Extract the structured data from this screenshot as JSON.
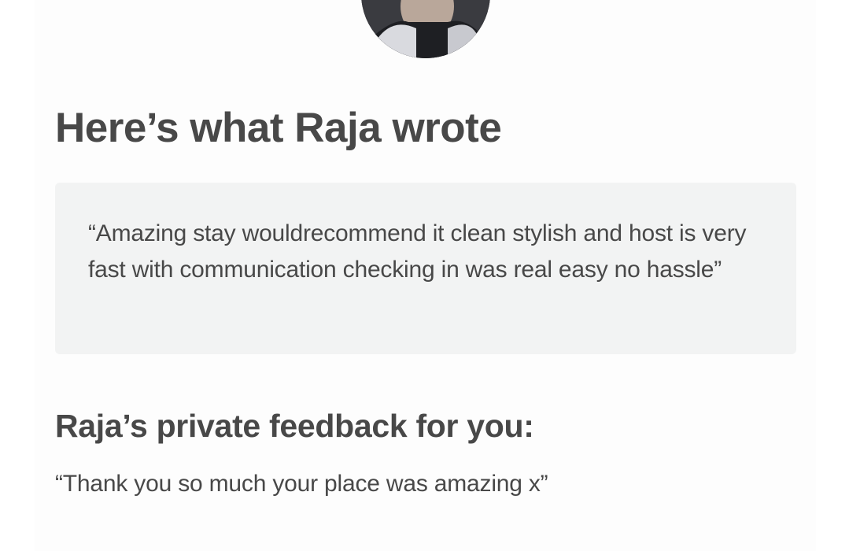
{
  "review": {
    "reviewer_name": "Raja",
    "heading": "Here’s what Raja wrote",
    "public_review": "“Amazing stay wouldrecommend it clean stylish and host is very fast with communication checking in was real easy no hassle”",
    "private_heading": "Raja’s private feedback for you:",
    "private_feedback": "“Thank you so much your place was amazing x”"
  },
  "colors": {
    "text": "#484848",
    "review_box_bg": "#f2f3f3",
    "page_bg": "#fdfdfd"
  }
}
